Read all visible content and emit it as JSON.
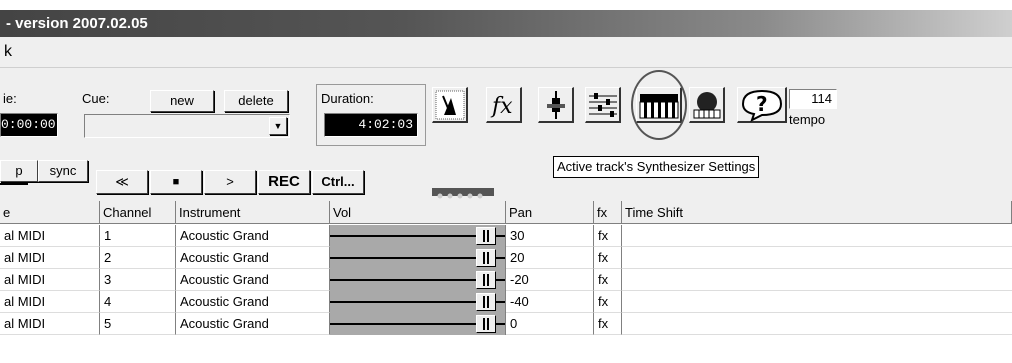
{
  "window": {
    "title": "- version 2007.02.05"
  },
  "menu": {
    "item": "k"
  },
  "toolbar": {
    "time_label": "ie:",
    "time_value": "0:00:00",
    "cue_label": "Cue:",
    "new_label": "new",
    "delete_label": "delete",
    "duration_label": "Duration:",
    "duration_value": "4:02:03",
    "tempo_value": "114",
    "tempo_label": "tempo",
    "tooltip": "Active track's Synthesizer Settings",
    "p_label": "p",
    "sync_label": "sync",
    "rewind_label": "≪",
    "stop_label": "■",
    "play_label": ">",
    "rec_label": "REC",
    "ctrl_label": "Ctrl..."
  },
  "grid": {
    "headers": {
      "device": "e",
      "channel": "Channel",
      "instrument": "Instrument",
      "vol": "Vol",
      "pan": "Pan",
      "fx": "fx",
      "timeshift": "Time Shift"
    },
    "rows": [
      {
        "device": "al MIDI",
        "channel": "1",
        "instrument": "Acoustic Grand",
        "pan": "30",
        "fx": "fx"
      },
      {
        "device": "al MIDI",
        "channel": "2",
        "instrument": "Acoustic Grand",
        "pan": "20",
        "fx": "fx"
      },
      {
        "device": "al MIDI",
        "channel": "3",
        "instrument": "Acoustic Grand",
        "pan": "-20",
        "fx": "fx"
      },
      {
        "device": "al MIDI",
        "channel": "4",
        "instrument": "Acoustic Grand",
        "pan": "-40",
        "fx": "fx"
      },
      {
        "device": "al MIDI",
        "channel": "5",
        "instrument": "Acoustic Grand",
        "pan": "0",
        "fx": "fx"
      }
    ]
  },
  "icons": [
    "metronome-icon",
    "fx-icon",
    "microphone-icon",
    "mixer-icon",
    "synthesizer-icon",
    "keyboard-record-icon",
    "help-icon"
  ]
}
